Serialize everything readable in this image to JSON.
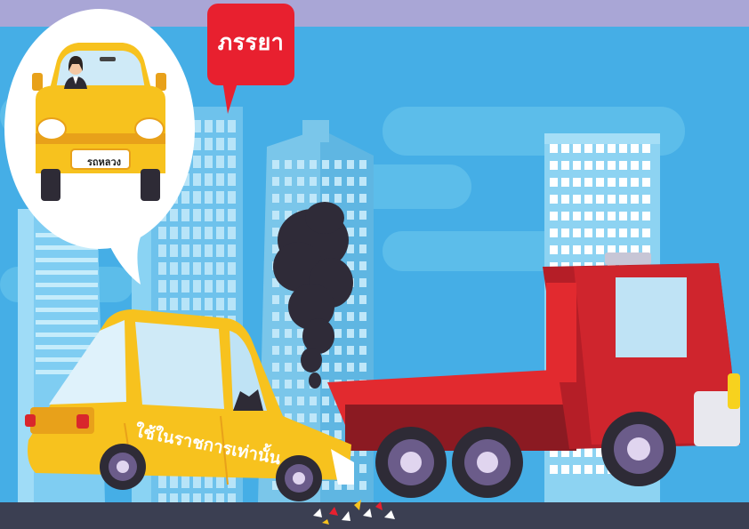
{
  "speech_bubble_label": "ภรรยา",
  "license_plate": "รถหลวง",
  "car_door_text": "ใช้ในราชการเท่านั้น",
  "colors": {
    "top_band": "#a9a6d6",
    "sky": "#45aee6",
    "ground": "#3b3f52",
    "taxi_yellow": "#f7c21e",
    "truck_red": "#d9262c",
    "speech_red": "#e8202f",
    "smoke": "#2f2b38"
  },
  "icons": [
    "woman-driver-icon",
    "yellow-car-icon",
    "tow-truck-icon",
    "smoke-icon",
    "glass-shards-icon"
  ]
}
